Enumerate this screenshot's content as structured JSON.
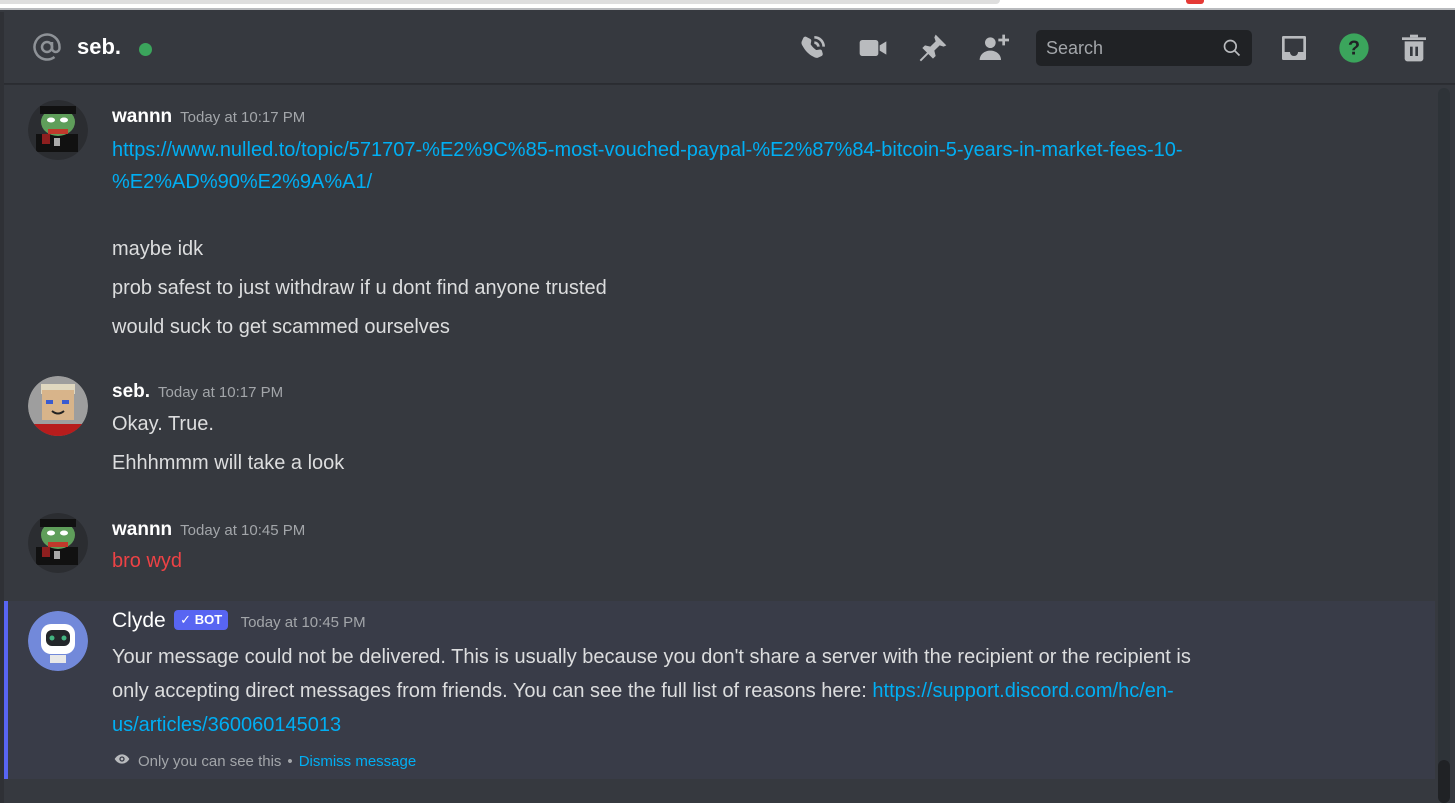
{
  "header": {
    "channel_title": "seb.",
    "status": "online",
    "status_color": "#3ba55c",
    "search_placeholder": "Search",
    "icons": [
      "at-icon",
      "start-voice-call-icon",
      "start-video-call-icon",
      "pinned-messages-icon",
      "add-friends-to-dm-icon",
      "search-icon",
      "inbox-icon",
      "help-icon",
      "trash-icon"
    ]
  },
  "messages": [
    {
      "author": "wannn",
      "timestamp": "Today at 10:17 PM",
      "link_line1": "https://www.nulled.to/topic/571707-%E2%9C%85-most-vouched-paypal-%E2%87%84-bitcoin-5-years-in-market-fees-10-",
      "link_line2": "%E2%AD%90%E2%9A%A1/",
      "lines": [
        "maybe idk",
        "prob safest to just withdraw if u dont find anyone trusted",
        "would suck to get scammed ourselves"
      ]
    },
    {
      "author": "seb.",
      "timestamp": "Today at 10:17 PM",
      "lines": [
        "Okay. True.",
        "Ehhhmmm will take a look"
      ]
    },
    {
      "author": "wannn",
      "timestamp": "Today at 10:45 PM",
      "lines": [
        "bro wyd"
      ],
      "failed": true
    },
    {
      "author": "Clyde",
      "badge": "BOT",
      "badge_check": "✓",
      "timestamp": "Today at 10:45 PM",
      "text_line1": "Your message could not be delivered. This is usually because you don't share a server with the recipient or the recipient is",
      "text_line2": "only accepting direct messages from friends. You can see the full list of reasons here: ",
      "link_part1": "https://support.discord.com/hc/en-",
      "link_part2": "us/articles/360060145013",
      "ephemeral_note": "Only you can see this",
      "separator": "•",
      "dismiss_label": "Dismiss message"
    }
  ],
  "colors": {
    "link": "#00aff4",
    "failed_text": "#ed4245",
    "bot_badge": "#5865f2",
    "background": "#36393f"
  }
}
